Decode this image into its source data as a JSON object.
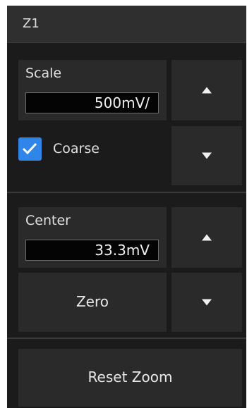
{
  "header": {
    "title": "Z1"
  },
  "scale": {
    "label": "Scale",
    "value": "500mV/"
  },
  "coarse": {
    "label": "Coarse",
    "checked": true
  },
  "center": {
    "label": "Center",
    "value": "33.3mV"
  },
  "zero": {
    "label": "Zero"
  },
  "reset": {
    "label": "Reset Zoom"
  },
  "icons": {
    "up": "arrow-up-icon",
    "down": "arrow-down-icon",
    "check": "checkmark-icon"
  },
  "colors": {
    "accent": "#2f86e8",
    "panel": "#1b1b1b",
    "tile": "#2a2a2a"
  }
}
